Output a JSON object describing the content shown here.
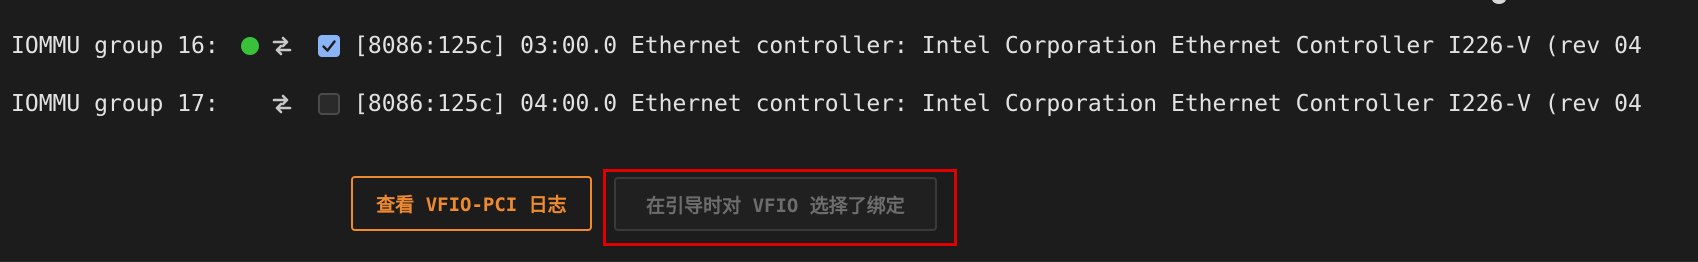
{
  "devices": [
    {
      "group_label": "IOMMU group 16:",
      "status": "active",
      "status_color": "#39c13a",
      "checked": true,
      "description": "[8086:125c] 03:00.0 Ethernet controller: Intel Corporation Ethernet Controller I226-V (rev 04"
    },
    {
      "group_label": "IOMMU group 17:",
      "status": "none",
      "checked": false,
      "description": "[8086:125c] 04:00.0 Ethernet controller: Intel Corporation Ethernet Controller I226-V (rev 04"
    }
  ],
  "icons": {
    "swap": "swap-icon",
    "status": "status-dot",
    "checkbox_checked": "checkbox-checked-icon"
  },
  "buttons": {
    "view_log_label": "查看 VFIO-PCI 日志",
    "bind_selected_label": "在引导时对 VFIO 选择了绑定"
  },
  "colors": {
    "accent_orange": "#f08a2e",
    "highlight_red": "#e00000",
    "checkbox_blue": "#8ab4f8",
    "background": "#1c1c1c"
  }
}
